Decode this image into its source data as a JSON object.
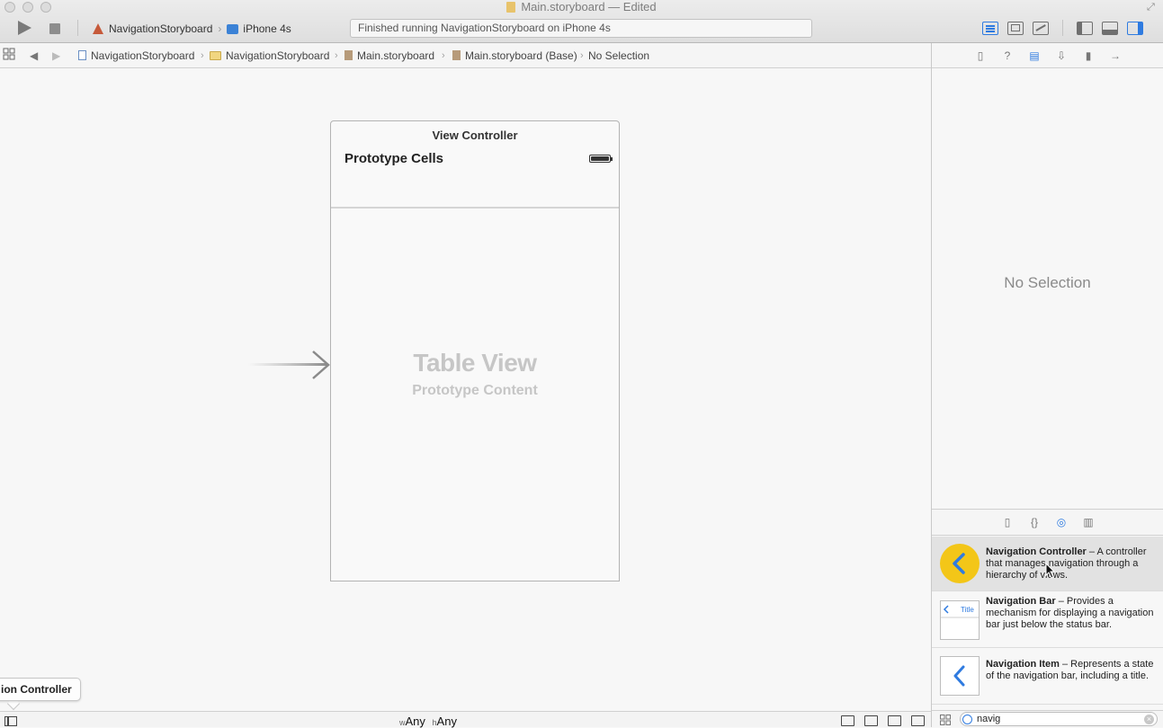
{
  "window": {
    "title": "Main.storyboard — Edited"
  },
  "toolbar": {
    "scheme_target": "NavigationStoryboard",
    "scheme_device": "iPhone 4s",
    "activity_status": "Finished running NavigationStoryboard on iPhone 4s"
  },
  "jumpbar": {
    "crumbs": [
      "NavigationStoryboard",
      "NavigationStoryboard",
      "Main.storyboard",
      "Main.storyboard (Base)",
      "No Selection"
    ]
  },
  "canvas": {
    "scene_title": "View Controller",
    "prototype_cells_label": "Prototype Cells",
    "table_view_title": "Table View",
    "table_view_subtitle": "Prototype Content",
    "drag_label": "ion Controller"
  },
  "bottombar": {
    "width_prefix": "w",
    "width_value": "Any",
    "height_prefix": "h",
    "height_value": "Any"
  },
  "inspector": {
    "no_selection": "No Selection"
  },
  "library": {
    "items": [
      {
        "name": "Navigation Controller",
        "desc": " – A controller that manages navigation through a hierarchy of views."
      },
      {
        "name": "Navigation Bar",
        "desc": " – Provides a mechanism for displaying a navigation bar just below the status bar."
      },
      {
        "name": "Navigation Item",
        "desc": " – Represents a state of the navigation bar, including a title."
      }
    ],
    "nav_bar_icon_title": "Title",
    "search_value": "navig"
  },
  "colors": {
    "accent": "#2f7be0",
    "nav_controller_icon": "#f3c618"
  }
}
